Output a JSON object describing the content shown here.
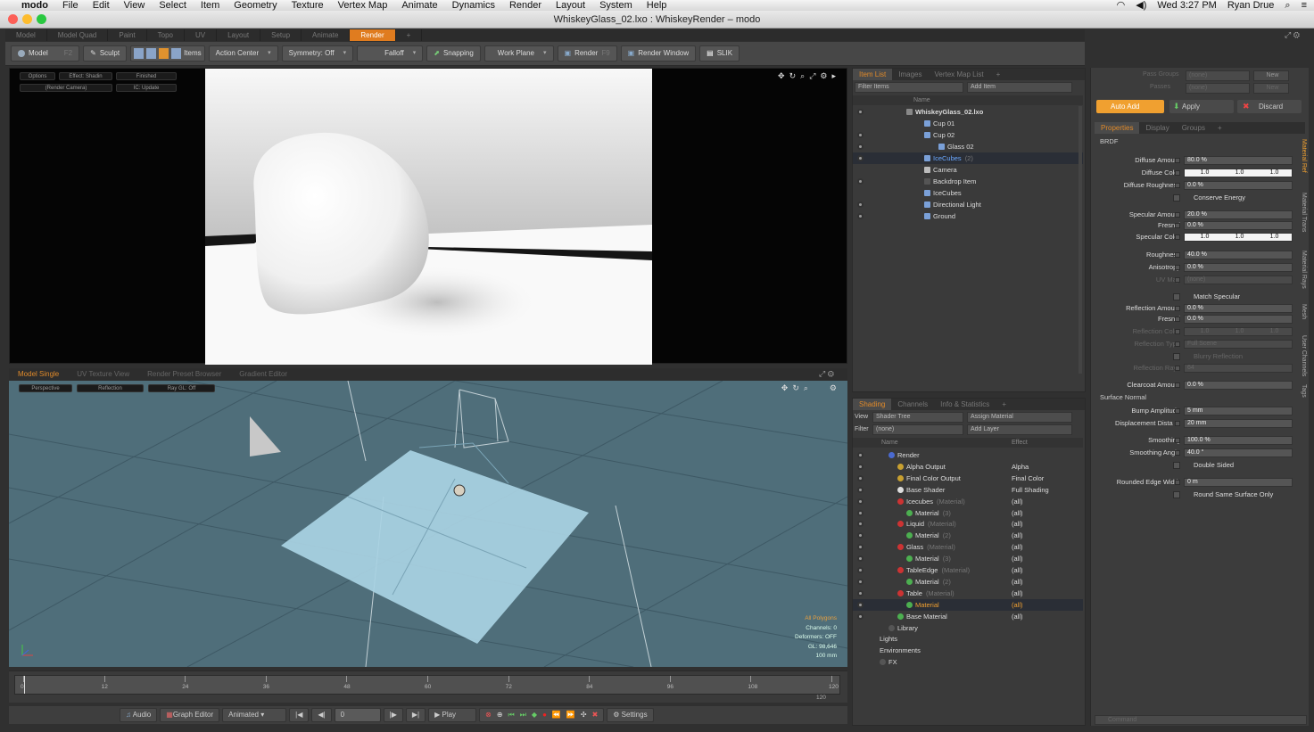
{
  "menubar": {
    "app": "modo",
    "items": [
      "File",
      "Edit",
      "View",
      "Select",
      "Item",
      "Geometry",
      "Texture",
      "Vertex Map",
      "Animate",
      "Dynamics",
      "Render",
      "Layout",
      "System",
      "Help"
    ],
    "clock": "Wed 3:27 PM",
    "user": "Ryan Drue"
  },
  "window": {
    "title": "WhiskeyGlass_02.lxo : WhiskeyRender – modo"
  },
  "layout_tabs": [
    "Model",
    "Model Quad",
    "Paint",
    "Topo",
    "UV",
    "Layout",
    "Setup",
    "Animate",
    "Render"
  ],
  "toolbar": {
    "model": "Model",
    "f2": "F2",
    "sculpt": "Sculpt",
    "items": "Items",
    "action_center": "Action Center",
    "symmetry": "Symmetry: Off",
    "falloff": "Falloff",
    "snapping": "Snapping",
    "work_plane": "Work Plane",
    "render": "Render",
    "f9": "F9",
    "render_window": "Render Window",
    "slik": "SLIK"
  },
  "render_view": {
    "options": "Options",
    "effect": "Effect: Shadin",
    "finished": "Finished",
    "camera": "(Render Camera)",
    "ic_update": "IC: Update"
  },
  "viewport_tabs": [
    "Model Single",
    "UV Texture View",
    "Render Preset Browser",
    "Gradient Editor"
  ],
  "model_view": {
    "perspective": "Perspective",
    "reflection": "Reflection",
    "ray_gl": "Ray GL: Off",
    "info": [
      "All Polygons",
      "Channels: 0",
      "Deformers: OFF",
      "GL: 98,646",
      "100 mm"
    ]
  },
  "timeline": {
    "ticks": [
      "0",
      "12",
      "24",
      "36",
      "48",
      "60",
      "72",
      "84",
      "96",
      "108",
      "120"
    ],
    "end_label": "120"
  },
  "transport": {
    "audio": "Audio",
    "graph_editor": "Graph Editor",
    "animated": "Animated",
    "frame": "0",
    "play": "Play",
    "settings": "Settings"
  },
  "item_list": {
    "tabs": [
      "Item List",
      "Images",
      "Vertex Map List"
    ],
    "filter": "Filter Items",
    "add_item": "Add Item",
    "col_name": "Name",
    "rows": [
      {
        "label": "WhiskeyGlass_02.lxo",
        "indent": 60,
        "bold": true
      },
      {
        "label": "Cup 01",
        "indent": 80
      },
      {
        "label": "Cup 02",
        "indent": 80
      },
      {
        "label": "Glass 02",
        "indent": 96
      },
      {
        "label": "IceCubes",
        "suffix": "(2)",
        "indent": 80,
        "hl": true
      },
      {
        "label": "Camera",
        "indent": 80
      },
      {
        "label": "Backdrop Item",
        "indent": 80
      },
      {
        "label": "IceCubes",
        "indent": 80
      },
      {
        "label": "Directional Light",
        "indent": 80
      },
      {
        "label": "Ground",
        "indent": 80
      }
    ]
  },
  "shading": {
    "tabs": [
      "Shading",
      "Channels",
      "Info & Statistics"
    ],
    "view_label": "View",
    "view_value": "Shader Tree",
    "assign": "Assign Material",
    "filter_label": "Filter",
    "filter_value": "(none)",
    "add_layer": "Add Layer",
    "col_name": "Name",
    "col_effect": "Effect",
    "rows": [
      {
        "label": "Render",
        "effect": "",
        "indent": 40,
        "color": "#4a6ad0"
      },
      {
        "label": "Alpha Output",
        "effect": "Alpha",
        "indent": 50,
        "color": "#c8a030"
      },
      {
        "label": "Final Color Output",
        "effect": "Final Color",
        "indent": 50,
        "color": "#c8a030"
      },
      {
        "label": "Base Shader",
        "effect": "Full Shading",
        "indent": 50,
        "color": "#dddddd"
      },
      {
        "label": "Icecubes",
        "suffix": "(Material)",
        "effect": "(all)",
        "indent": 50,
        "color": "#cc3333"
      },
      {
        "label": "Material",
        "suffix": "(3)",
        "effect": "(all)",
        "indent": 60,
        "color": "#4caf50"
      },
      {
        "label": "Liquid",
        "suffix": "(Material)",
        "effect": "(all)",
        "indent": 50,
        "color": "#cc3333"
      },
      {
        "label": "Material",
        "suffix": "(2)",
        "effect": "(all)",
        "indent": 60,
        "color": "#4caf50"
      },
      {
        "label": "Glass",
        "suffix": "(Material)",
        "effect": "(all)",
        "indent": 50,
        "color": "#cc3333"
      },
      {
        "label": "Material",
        "suffix": "(3)",
        "effect": "(all)",
        "indent": 60,
        "color": "#4caf50"
      },
      {
        "label": "TableEdge",
        "suffix": "(Material)",
        "effect": "(all)",
        "indent": 50,
        "color": "#cc3333"
      },
      {
        "label": "Material",
        "suffix": "(2)",
        "effect": "(all)",
        "indent": 60,
        "color": "#4caf50"
      },
      {
        "label": "Table",
        "suffix": "(Material)",
        "effect": "(all)",
        "indent": 50,
        "color": "#cc3333"
      },
      {
        "label": "Material",
        "effect": "(all)",
        "indent": 60,
        "color": "#4caf50",
        "hl": true
      },
      {
        "label": "Base Material",
        "effect": "(all)",
        "indent": 50,
        "color": "#4caf50"
      },
      {
        "label": "Library",
        "effect": "",
        "indent": 40,
        "color": "#555555"
      },
      {
        "label": "Lights",
        "effect": "",
        "indent": 30,
        "color": ""
      },
      {
        "label": "Environments",
        "effect": "",
        "indent": 30,
        "color": ""
      },
      {
        "label": "FX",
        "effect": "",
        "indent": 30,
        "color": "#555555"
      }
    ]
  },
  "properties": {
    "pass_groups": "Pass Groups",
    "passes": "Passes",
    "none": "(none)",
    "new": "New",
    "auto_add": "Auto Add",
    "apply": "Apply",
    "discard": "Discard",
    "tabs": [
      "Properties",
      "Display",
      "Groups"
    ],
    "section": "BRDF",
    "rows": [
      {
        "label": "Diffuse Amount",
        "value": "80.0 %"
      },
      {
        "label": "Diffuse Color",
        "rgb": [
          "1.0",
          "1.0",
          "1.0"
        ]
      },
      {
        "label": "Diffuse Roughness",
        "value": "0.0 %"
      },
      {
        "label": "",
        "check": "Conserve Energy"
      },
      {
        "label": "Specular Amount",
        "value": "20.0 %"
      },
      {
        "label": "Fresnel",
        "value": "0.0 %"
      },
      {
        "label": "Specular Color",
        "rgb": [
          "1.0",
          "1.0",
          "1.0"
        ]
      },
      {
        "label": "Roughness",
        "value": "40.0 %"
      },
      {
        "label": "Anisotropy",
        "value": "0.0 %"
      },
      {
        "label": "UV Map",
        "value": "(none)",
        "dim": true
      },
      {
        "label": "",
        "check": "Match Specular"
      },
      {
        "label": "Reflection Amount",
        "value": "0.0 %"
      },
      {
        "label": "Fresnel",
        "value": "0.0 %"
      },
      {
        "label": "Reflection Color",
        "rgb": [
          "1.0",
          "1.0",
          "1.0"
        ],
        "dim": true
      },
      {
        "label": "Reflection Type",
        "value": "Full Scene",
        "dim": true
      },
      {
        "label": "",
        "check": "Blurry Reflection",
        "dim": true
      },
      {
        "label": "Reflection Rays",
        "value": "64",
        "dim": true
      },
      {
        "label": "Clearcoat Amount",
        "value": "0.0 %"
      },
      {
        "label": "Surface Normal",
        "section": true
      },
      {
        "label": "Bump Amplitude",
        "value": "5 mm"
      },
      {
        "label": "Displacement Dista ...",
        "value": "20 mm"
      },
      {
        "label": "Smoothing",
        "value": "100.0 %"
      },
      {
        "label": "Smoothing Angle",
        "value": "40.0 °"
      },
      {
        "label": "",
        "check": "Double Sided"
      },
      {
        "label": "Rounded Edge Width",
        "value": "0 m"
      },
      {
        "label": "",
        "check": "Round Same Surface Only"
      }
    ],
    "side_tabs": [
      "Material Ref",
      "Material Trans",
      "Material Rays",
      "Mesh",
      "User Channels",
      "Tags"
    ],
    "command": "Command"
  }
}
